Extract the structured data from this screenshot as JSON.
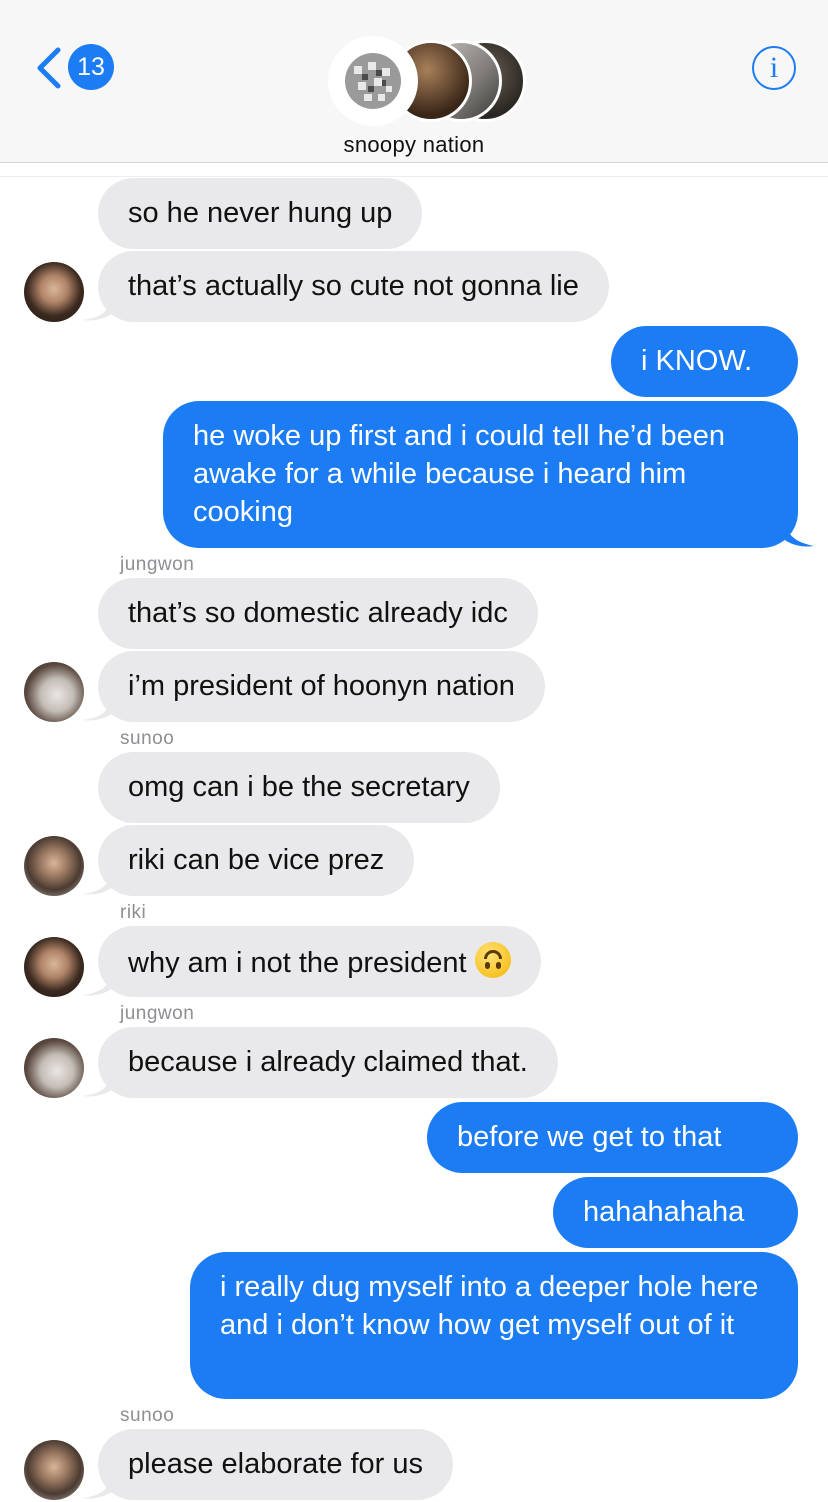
{
  "header": {
    "unread_count": "13",
    "group_name": "snoopy nation",
    "info_glyph": "i"
  },
  "messages": [
    {
      "text": "so he never hung up"
    },
    {
      "text": "that’s actually so cute not gonna lie"
    },
    {
      "text": "i KNOW."
    },
    {
      "text": "he woke up first and i could tell he’d been awake for a while because i heard him cooking"
    },
    {
      "sender": "jungwon"
    },
    {
      "text": "that’s so domestic already idc"
    },
    {
      "text": "i’m president of hoonyn nation"
    },
    {
      "sender": "sunoo"
    },
    {
      "text": "omg can i be the secretary"
    },
    {
      "text": "riki can be vice prez"
    },
    {
      "sender": "riki"
    },
    {
      "text": "why am i not the president",
      "emoji": "upside-down-face"
    },
    {
      "sender": "jungwon"
    },
    {
      "text": "because i already claimed that."
    },
    {
      "text": "before we get to that"
    },
    {
      "text": "hahahahaha"
    },
    {
      "text": "i really dug myself into a deeper hole here and i don’t know how get myself out of it"
    },
    {
      "sender": "sunoo"
    },
    {
      "text": "please elaborate for us"
    }
  ],
  "colors": {
    "accent": "#1c7cf4",
    "incoming_bubble": "#e9e9eb",
    "header_bg": "#f7f7f8"
  }
}
